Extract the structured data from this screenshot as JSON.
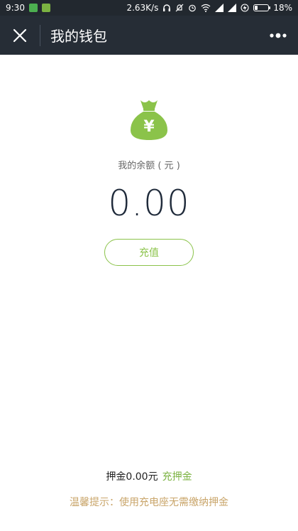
{
  "status_bar": {
    "time": "9:30",
    "speed": "2.63K/s",
    "battery": "18%"
  },
  "header": {
    "title": "我的钱包"
  },
  "wallet": {
    "balance_label": "我的余额 ( 元 )",
    "balance_amount": "0.00",
    "recharge_label": "充值",
    "currency_symbol": "¥"
  },
  "deposit": {
    "text": "押金0.00元",
    "link_label": "充押金"
  },
  "tip": {
    "text": "温馨提示：使用充电座无需缴纳押金"
  },
  "colors": {
    "accent": "#8bc34a",
    "header_bg": "#262d36",
    "tip": "#c9a56a"
  }
}
